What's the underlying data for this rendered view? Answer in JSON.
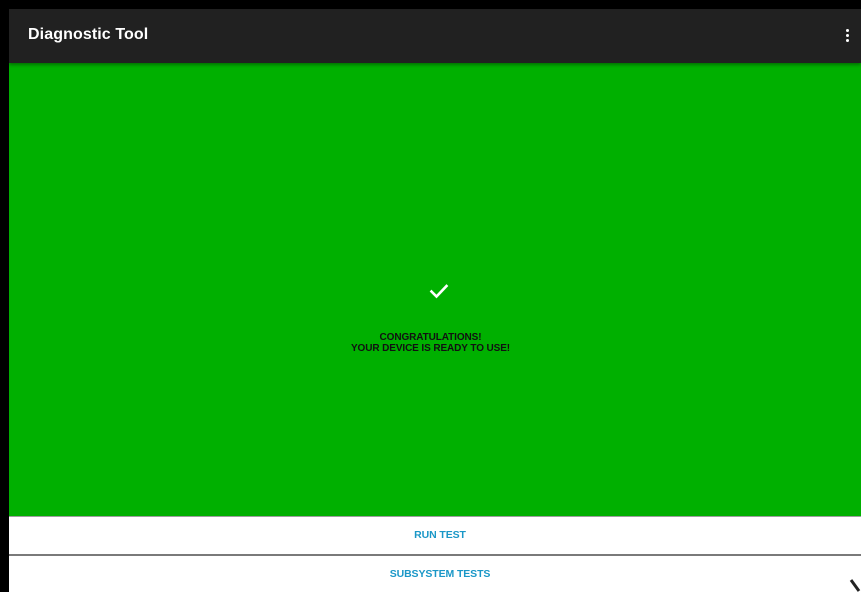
{
  "app_bar": {
    "title": "Diagnostic Tool",
    "background": "#212121",
    "overflow_icon": "more-vert-icon"
  },
  "status": {
    "background": "#00b000",
    "icon": "check-icon",
    "line1": "CONGRATULATIONS!",
    "line2": "YOUR DEVICE IS READY TO USE!"
  },
  "actions": [
    {
      "label": "RUN TEST"
    },
    {
      "label": "SUBSYSTEM TESTS",
      "icon": "chevron-right-icon"
    }
  ],
  "accent_color": "#1a97c7"
}
